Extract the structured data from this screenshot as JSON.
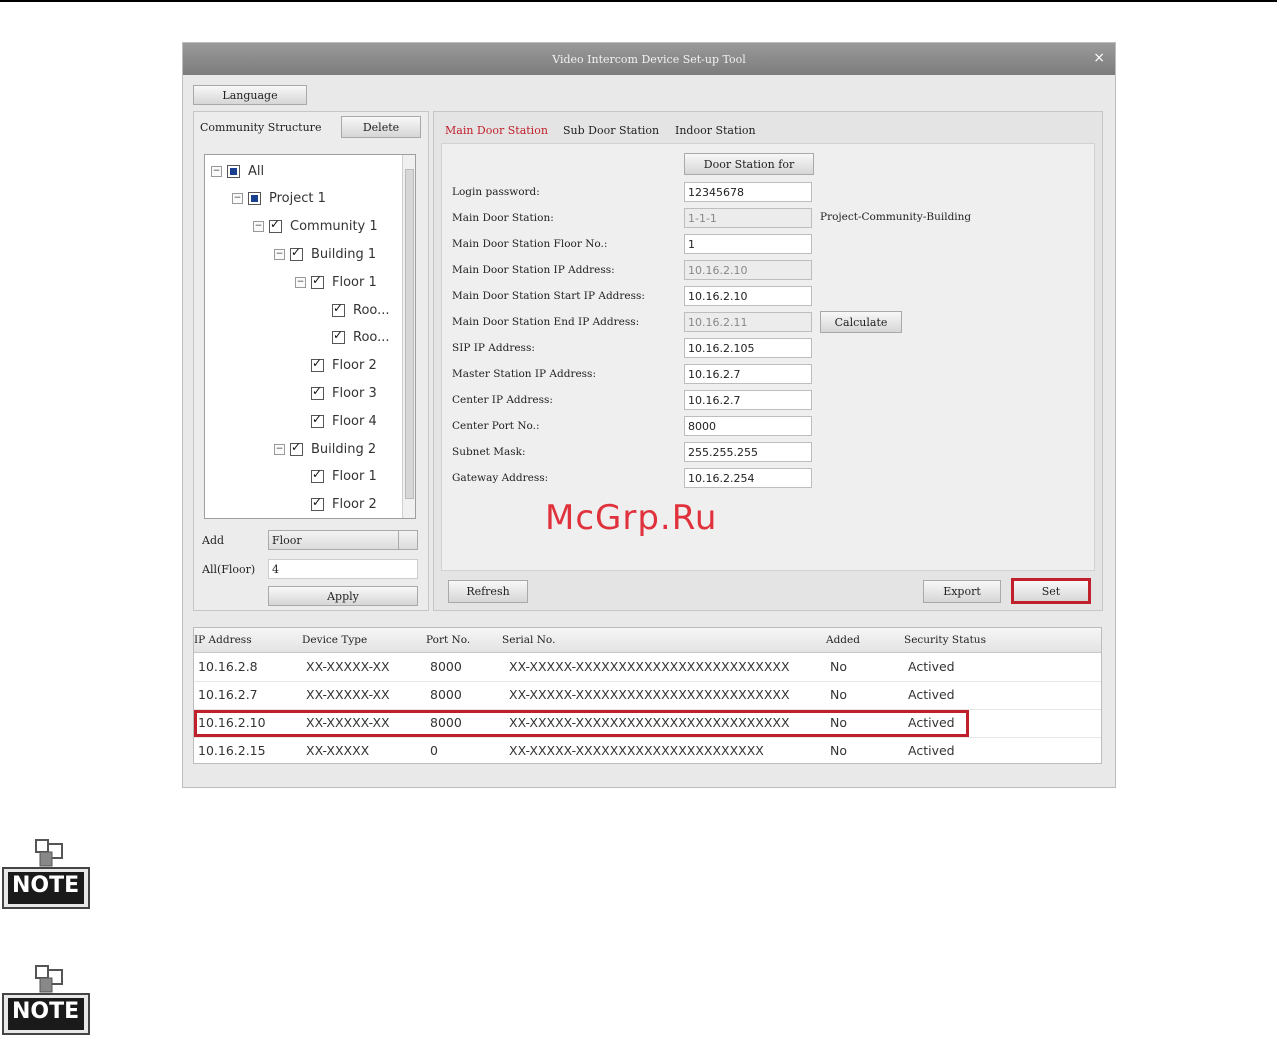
{
  "window": {
    "title": "Video Intercom Device Set-up Tool",
    "close_glyph": "×"
  },
  "language_button": "Language",
  "community": {
    "label": "Community Structure",
    "delete_button": "Delete",
    "tree": [
      {
        "label": "All",
        "level": 0,
        "expander": "−",
        "check": "part"
      },
      {
        "label": "Project 1",
        "level": 1,
        "expander": "−",
        "check": "part"
      },
      {
        "label": "Community 1",
        "level": 2,
        "expander": "−",
        "check": "on"
      },
      {
        "label": "Building 1",
        "level": 3,
        "expander": "−",
        "check": "on"
      },
      {
        "label": "Floor 1",
        "level": 4,
        "expander": "−",
        "check": "on"
      },
      {
        "label": "Roo...",
        "level": 5,
        "expander": "",
        "check": "on"
      },
      {
        "label": "Roo...",
        "level": 5,
        "expander": "",
        "check": "on"
      },
      {
        "label": "Floor 2",
        "level": 4,
        "expander": "",
        "check": "on"
      },
      {
        "label": "Floor 3",
        "level": 4,
        "expander": "",
        "check": "on"
      },
      {
        "label": "Floor 4",
        "level": 4,
        "expander": "",
        "check": "on"
      },
      {
        "label": "Building 2",
        "level": 3,
        "expander": "−",
        "check": "on"
      },
      {
        "label": "Floor 1",
        "level": 4,
        "expander": "",
        "check": "on"
      },
      {
        "label": "Floor 2",
        "level": 4,
        "expander": "",
        "check": "on"
      }
    ],
    "add_label": "Add",
    "add_value": "Floor",
    "all_floor_label": "All(Floor)",
    "all_floor_value": "4",
    "apply_button": "Apply"
  },
  "tabs": [
    "Main Door Station",
    "Sub Door Station",
    "Indoor Station"
  ],
  "door_station_for_button": "Door Station for",
  "form": [
    {
      "label": "Login password:",
      "value": "12345678",
      "disabled": false
    },
    {
      "label": "Main Door Station:",
      "value": "1-1-1",
      "disabled": true
    },
    {
      "label": "Main Door Station Floor No.:",
      "value": "1",
      "disabled": false
    },
    {
      "label": "Main Door Station IP Address:",
      "value": "10.16.2.10",
      "disabled": true
    },
    {
      "label": "Main Door Station Start IP Address:",
      "value": "10.16.2.10",
      "disabled": false
    },
    {
      "label": "Main Door Station End IP Address:",
      "value": "10.16.2.11",
      "disabled": true
    },
    {
      "label": "SIP IP Address:",
      "value": "10.16.2.105",
      "disabled": false
    },
    {
      "label": "Master Station IP Address:",
      "value": "10.16.2.7",
      "disabled": false
    },
    {
      "label": "Center IP Address:",
      "value": "10.16.2.7",
      "disabled": false
    },
    {
      "label": "Center Port No.:",
      "value": "8000",
      "disabled": false
    },
    {
      "label": "Subnet Mask:",
      "value": "255.255.255",
      "disabled": false
    },
    {
      "label": "Gateway Address:",
      "value": "10.16.2.254",
      "disabled": false
    }
  ],
  "main_door_hint": "Project-Community-Building",
  "calculate_button": "Calculate",
  "refresh_button": "Refresh",
  "export_button": "Export",
  "set_button": "Set",
  "list": {
    "headers": [
      "IP Address",
      "Device Type",
      "Port No.",
      "Serial No.",
      "Added",
      "Security Status"
    ],
    "rows": [
      [
        "10.16.2.8",
        "XX-XXXXX-XX",
        "8000",
        "XX-XXXXX-XXXXXXXXXXXXXXXXXXXXXXXXX",
        "No",
        "Actived"
      ],
      [
        "10.16.2.7",
        "XX-XXXXX-XX",
        "8000",
        "XX-XXXXX-XXXXXXXXXXXXXXXXXXXXXXXXX",
        "No",
        "Actived"
      ],
      [
        "10.16.2.10",
        "XX-XXXXX-XX",
        "8000",
        "XX-XXXXX-XXXXXXXXXXXXXXXXXXXXXXXXX",
        "No",
        "Actived"
      ],
      [
        "10.16.2.15",
        "XX-XXXXX",
        "0",
        "XX-XXXXX-XXXXXXXXXXXXXXXXXXXXXX",
        "No",
        "Actived"
      ]
    ]
  },
  "watermark": "McGrp.Ru",
  "note_label": "NOTE",
  "accent_color": "#c0202c"
}
